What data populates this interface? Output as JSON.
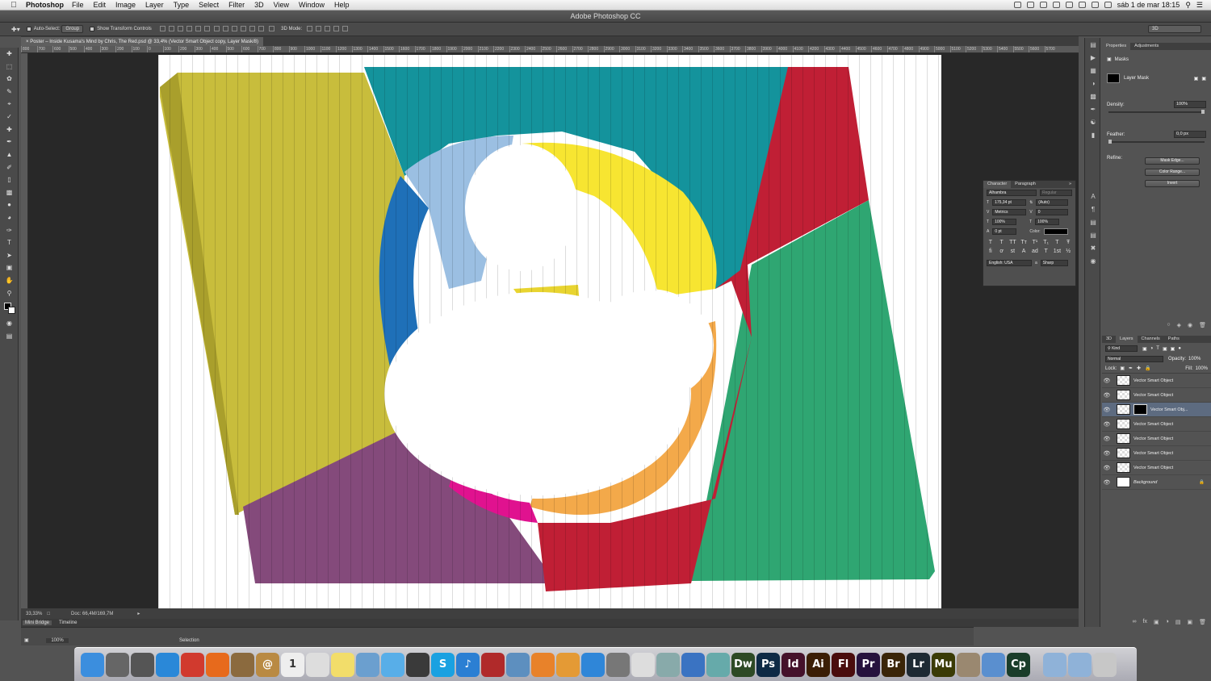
{
  "menubar": {
    "app_name": "Photoshop",
    "menus": [
      "File",
      "Edit",
      "Image",
      "Layer",
      "Type",
      "Select",
      "Filter",
      "3D",
      "View",
      "Window",
      "Help"
    ],
    "clock": "sáb 1 de mar  18:15"
  },
  "window": {
    "title": "Adobe Photoshop CC"
  },
  "options_bar": {
    "auto_select_label": "Auto-Select:",
    "auto_select_value": "Group",
    "show_transform_label": "Show Transform Controls",
    "mode_3d_label": "3D Mode:",
    "workspace": "3D"
  },
  "document": {
    "tab_title": "Poster – Inside Kusama's Mind by Chris, The Red.psd @ 33,4% (Vector Smart Object copy, Layer Mask/8)",
    "zoom": "33,33%",
    "doc_size": "Doc: 66,4M/169,7M",
    "ruler_labels": [
      "800",
      "700",
      "600",
      "500",
      "400",
      "300",
      "200",
      "100",
      "0",
      "100",
      "200",
      "300",
      "400",
      "500",
      "600",
      "700",
      "800",
      "900",
      "1000",
      "1100",
      "1200",
      "1300",
      "1400",
      "1500",
      "1600",
      "1700",
      "1800",
      "1900",
      "2000",
      "2100",
      "2200",
      "2300",
      "2400",
      "2500",
      "2600",
      "2700",
      "2800",
      "2900",
      "3000",
      "3100",
      "3200",
      "3300",
      "3400",
      "3500",
      "3600",
      "3700",
      "3800",
      "3900",
      "4000",
      "4100",
      "4200",
      "4300",
      "4400",
      "4500",
      "4600",
      "4700",
      "4800",
      "4900",
      "5000",
      "5100",
      "5200",
      "5300",
      "5400",
      "5500",
      "5600",
      "5700"
    ]
  },
  "bottom_panels": {
    "tabs": [
      "Mini Bridge",
      "Timeline"
    ],
    "zoom_value": "100%",
    "selection_label": "Selection"
  },
  "properties": {
    "tabs": [
      "Properties",
      "Adjustments"
    ],
    "section": "Masks",
    "mask_type": "Layer Mask",
    "density_label": "Density:",
    "density_value": "100%",
    "density_level": 1.0,
    "feather_label": "Feather:",
    "feather_value": "0,0 px",
    "feather_level": 0.0,
    "refine_label": "Refine:",
    "buttons": [
      "Mask Edge...",
      "Color Range...",
      "Invert"
    ]
  },
  "character": {
    "tabs": [
      "Character",
      "Paragraph"
    ],
    "font_family": "Alhambra",
    "font_style": "Regular",
    "font_size": "175,34 pt",
    "leading": "(Auto)",
    "kerning": "Metrics",
    "tracking": "0",
    "vert_scale": "100%",
    "horiz_scale": "100%",
    "baseline": "0 pt",
    "color_label": "Color:",
    "style_buttons_1": [
      "T",
      "T",
      "TT",
      "Tт",
      "T¹",
      "T₁",
      "T",
      "Ŧ"
    ],
    "style_buttons_2": [
      "fi",
      "ơ",
      "st",
      "A",
      "ad",
      "T",
      "1st",
      "½"
    ],
    "language": "English: USA",
    "antialias": "Sharp"
  },
  "layers": {
    "tabs": [
      "3D",
      "Layers",
      "Channels",
      "Paths"
    ],
    "filter_kind": "Kind",
    "blend_mode": "Normal",
    "opacity_label": "Opacity:",
    "opacity_value": "100%",
    "lock_label": "Lock:",
    "fill_label": "Fill:",
    "fill_value": "100%",
    "items": [
      {
        "name": "Vector Smart Object",
        "selected": false,
        "mask": false
      },
      {
        "name": "Vector Smart Object",
        "selected": false,
        "mask": false
      },
      {
        "name": "Vector Smart Obj...",
        "selected": true,
        "mask": true
      },
      {
        "name": "Vector Smart Object",
        "selected": false,
        "mask": false
      },
      {
        "name": "Vector Smart Object",
        "selected": false,
        "mask": false
      },
      {
        "name": "Vector Smart Object",
        "selected": false,
        "mask": false
      },
      {
        "name": "Vector Smart Object",
        "selected": false,
        "mask": false
      },
      {
        "name": "Background",
        "selected": false,
        "mask": false
      }
    ]
  },
  "toolbox": {
    "tools": [
      "move-tool",
      "marquee-tool",
      "lasso-tool",
      "quick-select-tool",
      "crop-tool",
      "eyedropper-tool",
      "healing-tool",
      "brush-tool",
      "stamp-tool",
      "history-brush-tool",
      "eraser-tool",
      "gradient-tool",
      "blur-tool",
      "dodge-tool",
      "pen-tool",
      "type-tool",
      "path-select-tool",
      "shape-tool",
      "hand-tool",
      "zoom-tool"
    ]
  },
  "colors": {
    "olive": "#c8bd3c",
    "teal": "#14939c",
    "red": "#c01f35",
    "green": "#2fa672",
    "purple": "#844a7b",
    "orange": "#f3a94a",
    "yellow": "#f7e531",
    "blue": "#1f70b8",
    "lightblue": "#9bbfe2",
    "magenta": "#e0128f"
  },
  "dock": {
    "apps": [
      {
        "name": "finder",
        "label": "",
        "color": "#3b8ede"
      },
      {
        "name": "launchpad",
        "label": "",
        "color": "#666"
      },
      {
        "name": "mission-control",
        "label": "",
        "color": "#555"
      },
      {
        "name": "safari",
        "label": "",
        "color": "#2a88d8"
      },
      {
        "name": "chrome",
        "label": "",
        "color": "#d13a2e"
      },
      {
        "name": "firefox",
        "label": "",
        "color": "#e76a1c"
      },
      {
        "name": "mail-stamp",
        "label": "",
        "color": "#8b6a3e"
      },
      {
        "name": "address-book",
        "label": "@",
        "color": "#b98a43"
      },
      {
        "name": "calendar",
        "label": "1",
        "color": "#eee"
      },
      {
        "name": "reminders",
        "label": "",
        "color": "#ddd"
      },
      {
        "name": "notes",
        "label": "",
        "color": "#f2dd6a"
      },
      {
        "name": "preview",
        "label": "",
        "color": "#6b9fcf"
      },
      {
        "name": "messages",
        "label": "",
        "color": "#58aee8"
      },
      {
        "name": "facetime",
        "label": "",
        "color": "#3a3a3a"
      },
      {
        "name": "skype",
        "label": "S",
        "color": "#1aa1e1"
      },
      {
        "name": "itunes",
        "label": "♪",
        "color": "#2b7fd3"
      },
      {
        "name": "photo-booth",
        "label": "",
        "color": "#b02a2a"
      },
      {
        "name": "iphoto",
        "label": "",
        "color": "#5d8fbf"
      },
      {
        "name": "ibooks",
        "label": "",
        "color": "#e8822a"
      },
      {
        "name": "pages",
        "label": "",
        "color": "#e49a35"
      },
      {
        "name": "app-store",
        "label": "",
        "color": "#2f86d8"
      },
      {
        "name": "system-prefs",
        "label": "",
        "color": "#777"
      },
      {
        "name": "textedit",
        "label": "",
        "color": "#ddd"
      },
      {
        "name": "grapher",
        "label": "",
        "color": "#8aa"
      },
      {
        "name": "keynote",
        "label": "",
        "color": "#3a73c2"
      },
      {
        "name": "colors-app",
        "label": "",
        "color": "#6aa"
      },
      {
        "name": "dreamweaver",
        "label": "Dw",
        "color": "#2e4a25"
      },
      {
        "name": "photoshop",
        "label": "Ps",
        "color": "#0e2a45"
      },
      {
        "name": "indesign",
        "label": "Id",
        "color": "#45122b"
      },
      {
        "name": "illustrator",
        "label": "Ai",
        "color": "#3b1e05"
      },
      {
        "name": "flash",
        "label": "Fl",
        "color": "#4a0d0d"
      },
      {
        "name": "premiere",
        "label": "Pr",
        "color": "#26123d"
      },
      {
        "name": "bridge",
        "label": "Br",
        "color": "#3a2508"
      },
      {
        "name": "lightroom",
        "label": "Lr",
        "color": "#1e2a33"
      },
      {
        "name": "muse",
        "label": "Mu",
        "color": "#3a3b06"
      },
      {
        "name": "gimp",
        "label": "",
        "color": "#9a8870"
      },
      {
        "name": "network-util",
        "label": "",
        "color": "#5a8fcf"
      },
      {
        "name": "captivate",
        "label": "Cp",
        "color": "#1a3d2a"
      },
      {
        "name": "downloads-stack",
        "label": "",
        "color": "#8fb2d8"
      },
      {
        "name": "documents-stack",
        "label": "",
        "color": "#8fb2d8"
      },
      {
        "name": "trash",
        "label": "",
        "color": "#c7c7c7"
      }
    ]
  }
}
